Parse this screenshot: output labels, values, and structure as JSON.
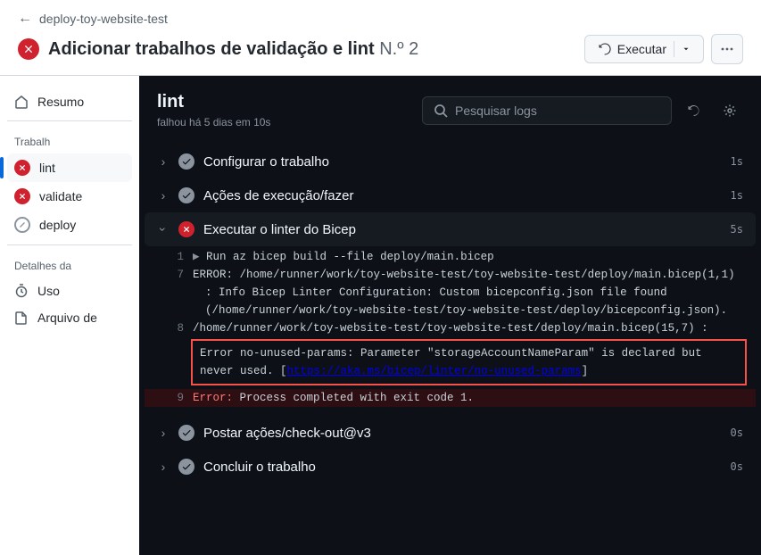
{
  "breadcrumb": "deploy-toy-website-test",
  "title": "Adicionar trabalhos de validação e lint",
  "run_number": "N.º 2",
  "rerun_label": "Executar",
  "sidebar": {
    "summary": "Resumo",
    "jobs_header": "Trabalh",
    "jobs": [
      {
        "label": "lint",
        "status": "error"
      },
      {
        "label": "validate",
        "status": "error"
      },
      {
        "label": "deploy",
        "status": "skipped"
      }
    ],
    "details_header": "Detalhes da",
    "usage": "Uso",
    "artifacts": "Arquivo de"
  },
  "main": {
    "title": "lint",
    "subtitle": "falhou há 5 dias em 10s",
    "search_placeholder": "Pesquisar logs"
  },
  "steps": [
    {
      "label": "Configurar o trabalho",
      "status": "ok",
      "duration": "1s",
      "expanded": false
    },
    {
      "label": "Ações de execução/fazer",
      "status": "ok",
      "duration": "1s",
      "expanded": false
    },
    {
      "label": "Executar o linter do Bicep",
      "status": "err",
      "duration": "5s",
      "expanded": true
    },
    {
      "label": "Postar ações/check-out@v3",
      "status": "ok",
      "duration": "0s",
      "expanded": false
    },
    {
      "label": "Concluir o trabalho",
      "status": "ok",
      "duration": "0s",
      "expanded": false
    }
  ],
  "log": {
    "line1_num": "1",
    "line1_pre": "▶ ",
    "line1_txt": "Run az bicep build --file deploy/main.bicep",
    "line7_num": "7",
    "line7_txt": "ERROR: /home/runner/work/toy-website-test/toy-website-test/deploy/main.bicep(1,1) : Info Bicep Linter Configuration: Custom bicepconfig.json file found (/home/runner/work/toy-website-test/toy-website-test/deploy/bicepconfig.json).",
    "line8_num": "8",
    "line8_txt": "/home/runner/work/toy-website-test/toy-website-test/deploy/main.bicep(15,7) : ",
    "highlight_pre": "Error no-unused-params: Parameter \"storageAccountNameParam\" is declared but never used. [",
    "highlight_link": "https://aka.ms/bicep/linter/no-unused-params",
    "highlight_post": "]",
    "line9_num": "9",
    "line9_err": "Error:",
    "line9_txt": " Process completed with exit code 1."
  }
}
